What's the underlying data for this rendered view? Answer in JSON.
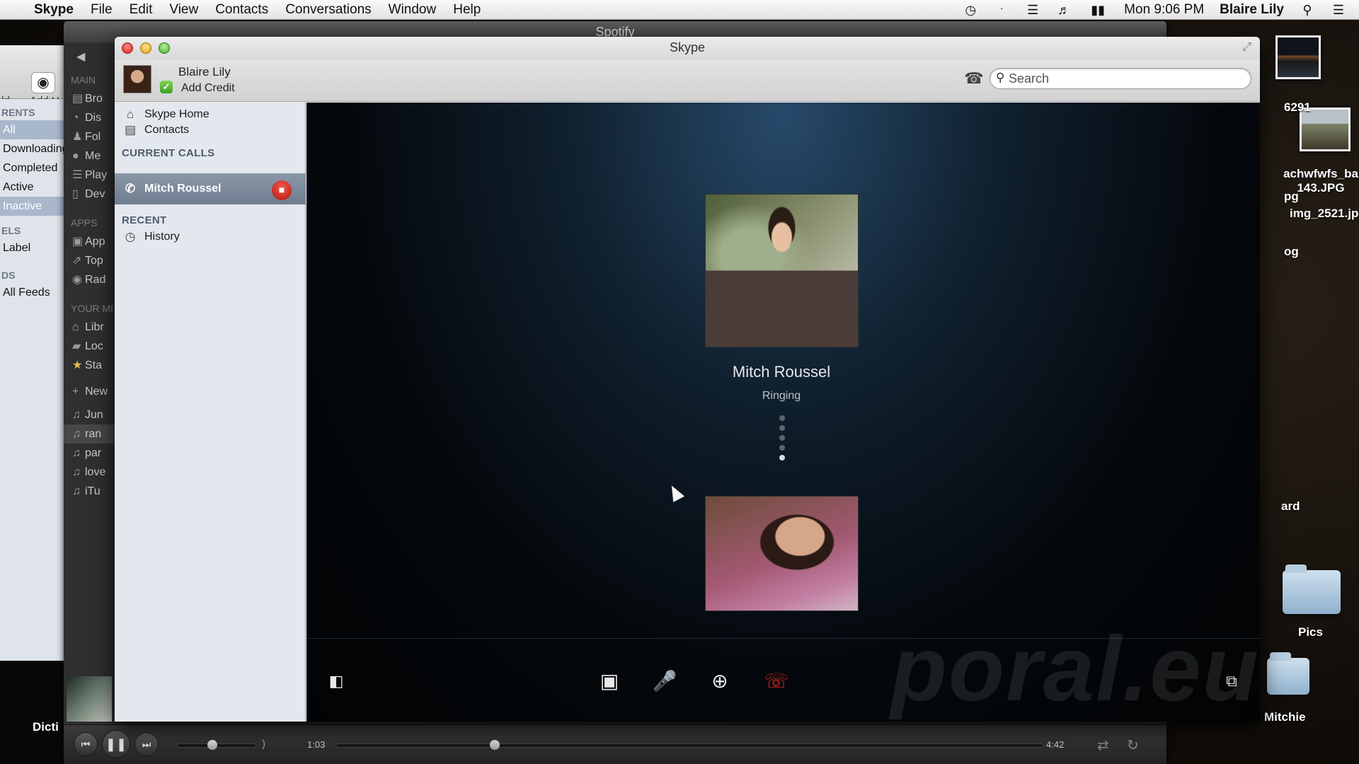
{
  "menubar": {
    "app": "Skype",
    "items": [
      "File",
      "Edit",
      "View",
      "Contacts",
      "Conversations",
      "Window",
      "Help"
    ],
    "clock": "Mon 9:06 PM",
    "user": "Blaire Lily"
  },
  "desktop": {
    "labels": [
      "6291",
      "achwfwfs_ba 143.JPG",
      "img_2521.jp",
      "og",
      "ard",
      "Pics",
      "Mitchie",
      "pg",
      "Dicti"
    ]
  },
  "torrent_window": {
    "toolbar_labels": [
      "ld",
      "Add U"
    ],
    "sections": [
      "RENTS",
      "ELS",
      "DS"
    ],
    "items": [
      "All",
      "Downloading",
      "Completed",
      "Active",
      "Inactive",
      "Label",
      "All Feeds"
    ]
  },
  "spotify": {
    "title": "Spotify",
    "sections": [
      "MAIN",
      "APPS",
      "YOUR MI"
    ],
    "main_items": [
      "Bro",
      "Dis",
      "Fol",
      "Me",
      "Play",
      "Dev"
    ],
    "app_items": [
      "App",
      "Top",
      "Rad"
    ],
    "library_items": [
      "Libr",
      "Loc",
      "Sta"
    ],
    "new_playlist": "New",
    "playlists": [
      "Jun",
      "ran",
      "par",
      "love",
      "iTu"
    ],
    "player": {
      "elapsed": "1:03",
      "total": "4:42",
      "progress": 0.225,
      "volume": 0.45
    }
  },
  "skype": {
    "title": "Skype",
    "profile": {
      "name": "Blaire Lily",
      "credit": "Add Credit",
      "status": "online"
    },
    "search_placeholder": "Search",
    "sidebar": {
      "home": "Skype Home",
      "contacts": "Contacts",
      "current_calls_title": "CURRENT CALLS",
      "current_call": "Mitch Roussel",
      "recent_title": "RECENT",
      "history": "History"
    },
    "call": {
      "remote_name": "Mitch Roussel",
      "status": "Ringing"
    },
    "watermark": "poral.eu"
  }
}
